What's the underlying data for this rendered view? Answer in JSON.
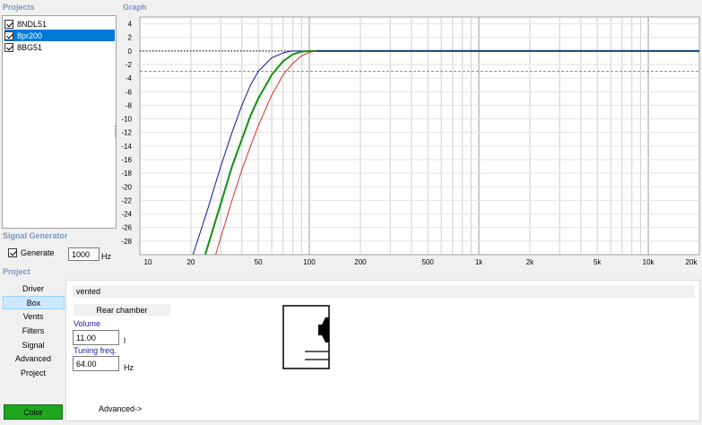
{
  "sections": {
    "projects": "Projects",
    "graph": "Graph",
    "signal_generator": "Signal Generator",
    "project": "Project"
  },
  "projects": [
    {
      "name": "8NDL51",
      "checked": true,
      "selected": false
    },
    {
      "name": "8pr200",
      "checked": true,
      "selected": true
    },
    {
      "name": "8BG51",
      "checked": true,
      "selected": false
    }
  ],
  "signal_generator": {
    "generate_label": "Generate",
    "generate_checked": true,
    "frequency": "1000",
    "unit": "Hz"
  },
  "nav": {
    "items": [
      "Driver",
      "Box",
      "Vents",
      "Filters",
      "Signal",
      "Advanced",
      "Project"
    ],
    "selected": "Box",
    "color_button": "Color"
  },
  "box": {
    "type": "vented",
    "rear_chamber": "Rear chamber",
    "volume_label": "Volume",
    "volume_value": "11.00",
    "volume_unit": "l",
    "tuning_label": "Tuning freq.",
    "tuning_value": "64.00",
    "tuning_unit": "Hz",
    "advanced_link": "Advanced->"
  },
  "colors": {
    "accent_blue": "#0078d7",
    "section_header": "#7a99c2",
    "color_button": "#1fa61f",
    "series_blue": "#1414a0",
    "series_green": "#109010",
    "series_red": "#d03030",
    "zero_line": "#1e4a78"
  },
  "chart_data": {
    "type": "line",
    "x_scale": "log",
    "xlim": [
      10,
      20000
    ],
    "ylim": [
      -30,
      5
    ],
    "y_ticks": [
      4,
      2,
      0,
      -2,
      -4,
      -6,
      -8,
      -10,
      -12,
      -14,
      -16,
      -18,
      -20,
      -22,
      -24,
      -26,
      -28
    ],
    "y_tick_labels": [
      "4",
      "2",
      "0",
      "-2",
      "-4",
      "-6",
      "-8",
      "-10",
      "-12",
      "-14",
      "-16",
      "-18",
      "-20",
      "-22",
      "-24",
      "-26",
      "-28"
    ],
    "x_ticks": [
      10,
      20,
      50,
      100,
      200,
      500,
      1000,
      2000,
      5000,
      10000,
      20000
    ],
    "x_tick_labels": [
      "10",
      "20",
      "50",
      "100",
      "200",
      "500",
      "1k",
      "2k",
      "5k",
      "10k",
      "20k"
    ],
    "reference_lines": [
      {
        "y": 0,
        "style": "dotted"
      },
      {
        "y": -3,
        "style": "dashed"
      }
    ],
    "grid": true,
    "series": [
      {
        "color": "#1414a0",
        "x": [
          20.6,
          25,
          30,
          35,
          40,
          45,
          50,
          60,
          70,
          75,
          80,
          20000
        ],
        "y": [
          -30,
          -23.5,
          -17,
          -12,
          -8,
          -5,
          -3,
          -1,
          -0.3,
          -0.1,
          0,
          0
        ]
      },
      {
        "color": "#109010",
        "x": [
          24.3,
          30,
          35,
          40,
          45,
          50,
          60,
          70,
          80,
          90,
          100,
          20000
        ],
        "y": [
          -30,
          -22.5,
          -17,
          -13,
          -9.5,
          -7,
          -3.5,
          -1.5,
          -0.5,
          -0.1,
          0,
          0
        ]
      },
      {
        "color": "#d03030",
        "x": [
          28,
          35,
          40,
          45,
          50,
          60,
          70,
          80,
          90,
          100,
          110,
          20000
        ],
        "y": [
          -30,
          -22,
          -17.5,
          -14,
          -11,
          -6.5,
          -3.5,
          -1.8,
          -0.7,
          -0.2,
          0,
          0
        ]
      }
    ]
  }
}
